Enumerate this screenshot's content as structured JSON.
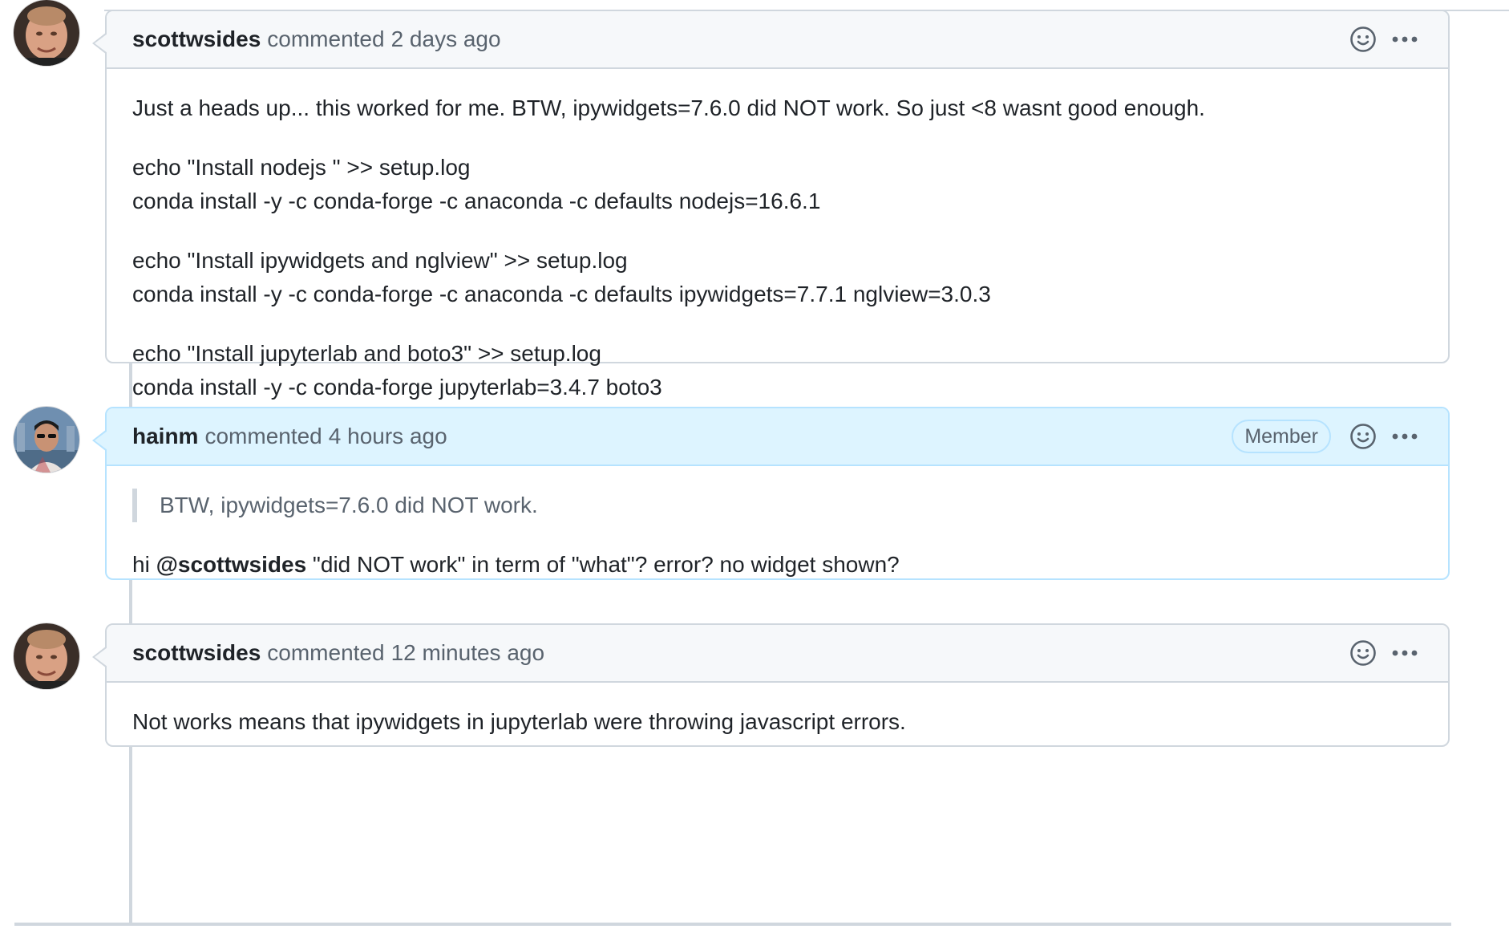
{
  "comments": [
    {
      "author": "scottwsides",
      "action": "commented",
      "time": "2 days ago",
      "body": [
        [
          "Just a heads up... this worked for me. BTW, ipywidgets=7.6.0 did NOT work. So just <8 wasnt good enough."
        ],
        [
          "echo \"Install nodejs \" >> setup.log",
          "conda install -y -c conda-forge -c anaconda -c defaults nodejs=16.6.1"
        ],
        [
          "echo \"Install ipywidgets and nglview\" >> setup.log",
          "conda install -y -c conda-forge -c anaconda -c defaults ipywidgets=7.7.1 nglview=3.0.3"
        ],
        [
          "echo \"Install jupyterlab and boto3\" >> setup.log",
          "conda install -y -c conda-forge jupyterlab=3.4.7 boto3"
        ]
      ]
    },
    {
      "author": "hainm",
      "action": "commented",
      "time": "4 hours ago",
      "badge": "Member",
      "quote": "BTW, ipywidgets=7.6.0 did NOT work.",
      "body_prefix": "hi ",
      "mention": "@scottwsides",
      "body_suffix": " \"did NOT work\" in term of \"what\"? error? no widget shown?"
    },
    {
      "author": "scottwsides",
      "action": "commented",
      "time": "12 minutes ago",
      "body": "Not works means that ipywidgets in jupyterlab were throwing javascript errors."
    }
  ],
  "icons": {
    "reaction": "smiley-icon",
    "menu": "kebab-horizontal-icon"
  },
  "colors": {
    "header_bg": "#f6f8fa",
    "member_header_bg": "#ddf4ff",
    "member_border": "#b6e3ff",
    "border": "#d0d7de",
    "muted_text": "#59636e"
  }
}
